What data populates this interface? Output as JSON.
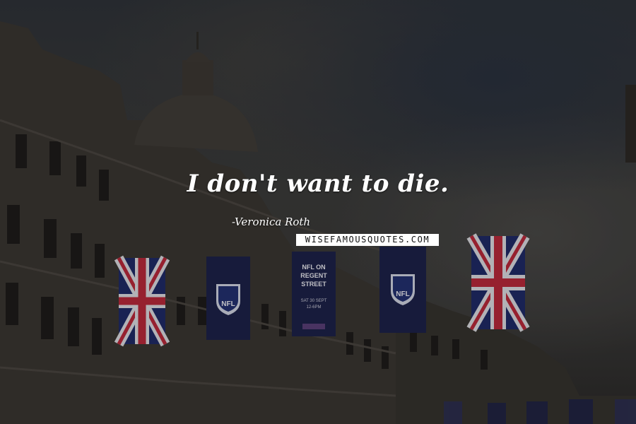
{
  "quote": {
    "text": "I don't want to die.",
    "author": "-Veronica Roth"
  },
  "watermark": {
    "text": "WISEFAMOUSQUOTES.COM"
  },
  "banners": {
    "nfl_logo_text": "NFL",
    "regent_street_line1": "NFL ON",
    "regent_street_line2": "REGENT",
    "regent_street_line3": "STREET",
    "regent_street_date": "SAT 30 SEPT",
    "regent_street_time": "12-6PM"
  },
  "colors": {
    "sky": "#3b3b3a",
    "building_stone": "#3a3631",
    "banner_navy": "#1d2148",
    "union_jack_red": "#b8293a",
    "union_jack_blue": "#1f2a66",
    "text": "#ffffff"
  }
}
